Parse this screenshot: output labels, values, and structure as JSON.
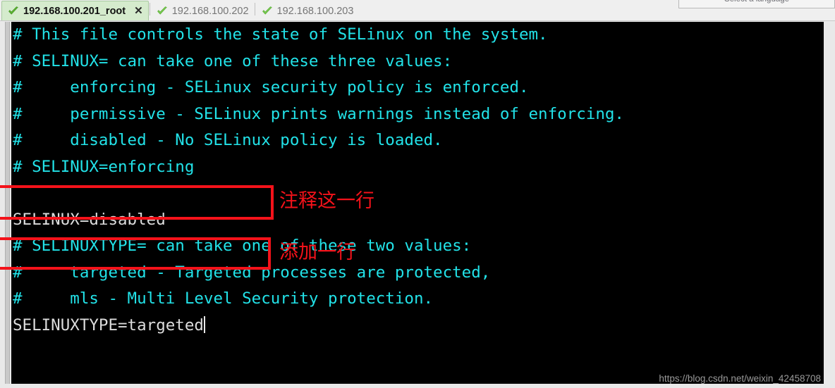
{
  "colors": {
    "terminal_bg": "#000000",
    "terminal_fg": "#22e2e8",
    "terminal_plain_fg": "#dcdcdc",
    "annotation_red": "#f4121a",
    "active_tab_bg": "#d5ebcd",
    "check_green": "#5bb431",
    "watermark_fg": "#9a9a9a"
  },
  "language_popup": {
    "label": "Select a language"
  },
  "tabbar": {
    "tabs": [
      {
        "label": "192.168.100.201_root",
        "icon": "check-icon",
        "active": true,
        "close_label": "✕"
      },
      {
        "label": "192.168.100.202",
        "icon": "check-icon",
        "active": false
      },
      {
        "label": "192.168.100.203",
        "icon": "check-icon",
        "active": false
      }
    ]
  },
  "terminal": {
    "lines": [
      {
        "text": "# This file controls the state of SELinux on the system.",
        "style": "comment"
      },
      {
        "text": "# SELINUX= can take one of these three values:",
        "style": "comment"
      },
      {
        "text": "#     enforcing - SELinux security policy is enforced.",
        "style": "comment"
      },
      {
        "text": "#     permissive - SELinux prints warnings instead of enforcing.",
        "style": "comment"
      },
      {
        "text": "#     disabled - No SELinux policy is loaded.",
        "style": "comment"
      },
      {
        "text": "# SELINUX=enforcing",
        "style": "comment"
      },
      {
        "text": "",
        "style": "blank"
      },
      {
        "text": "SELINUX=disabled",
        "style": "plain"
      },
      {
        "text": "# SELINUXTYPE= can take one of these two values:",
        "style": "comment"
      },
      {
        "text": "#     targeted - Targeted processes are protected,",
        "style": "comment"
      },
      {
        "text": "#     mls - Multi Level Security protection.",
        "style": "comment"
      },
      {
        "text": "SELINUXTYPE=targeted",
        "style": "plain",
        "cursor": true
      }
    ]
  },
  "annotations": [
    {
      "id": "comment-this-line",
      "text": "注释这一行"
    },
    {
      "id": "add-a-line",
      "text": "添加一行"
    }
  ],
  "watermark": {
    "text": "https://blog.csdn.net/weixin_42458708"
  }
}
